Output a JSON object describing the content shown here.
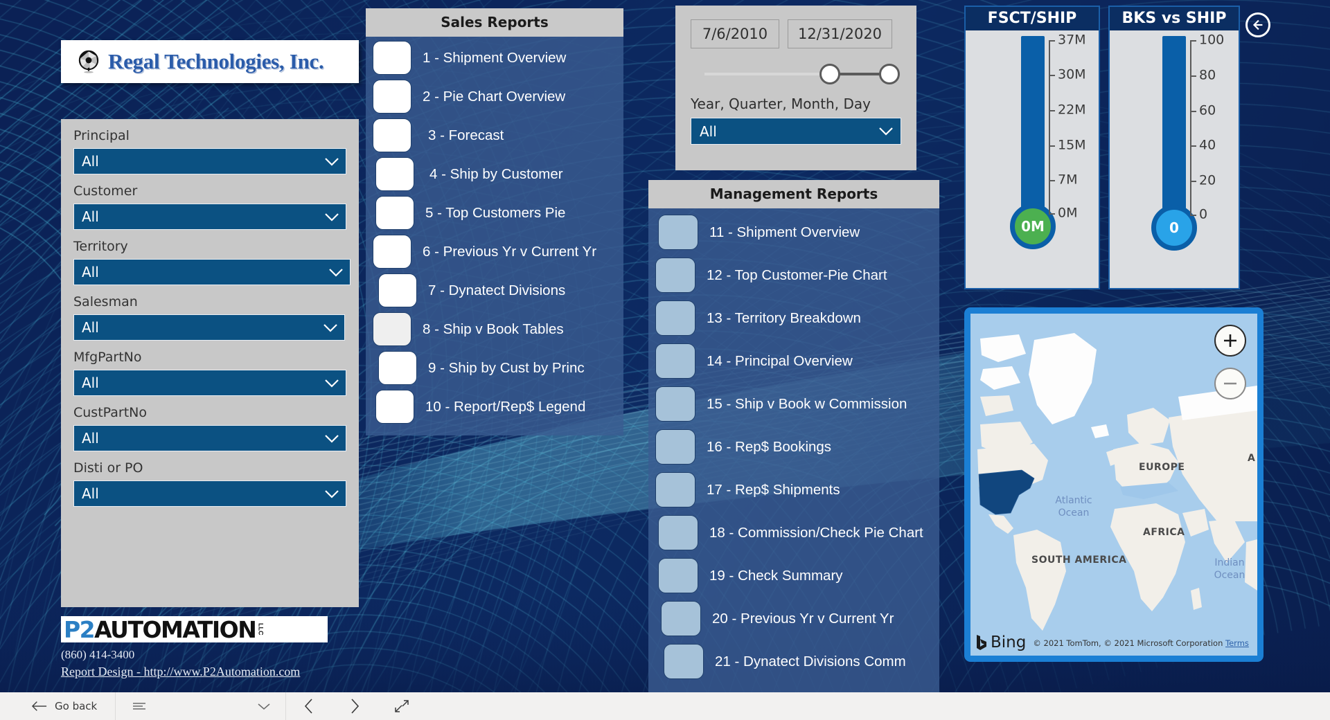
{
  "brand": {
    "company_name": "Regal Technologies, Inc.",
    "logo_icon": "camera-aperture-icon"
  },
  "filters": {
    "items": [
      {
        "label": "Principal",
        "value": "All"
      },
      {
        "label": "Customer",
        "value": "All"
      },
      {
        "label": "Territory",
        "value": "All"
      },
      {
        "label": "Salesman",
        "value": "All"
      },
      {
        "label": "MfgPartNo",
        "value": "All"
      },
      {
        "label": "CustPartNo",
        "value": "All"
      },
      {
        "label": "Disti or PO",
        "value": "All"
      }
    ]
  },
  "footer": {
    "logo_p2": "P2",
    "logo_automation": "AUTOMATION",
    "logo_suffix": "LLC",
    "phone": "(860) 414-3400",
    "link_text": "Report Design - http://www.P2Automation.com"
  },
  "sales_reports": {
    "header": "Sales Reports",
    "items": [
      "1 - Shipment Overview",
      "2 - Pie Chart Overview",
      "3 - Forecast",
      "4 - Ship by Customer",
      "5 - Top Customers Pie",
      "6 - Previous Yr v Current Yr",
      "7 - Dynatect Divisions",
      "8 - Ship v Book Tables",
      "9 - Ship by Cust by Princ",
      "10 - Report/Rep$ Legend"
    ]
  },
  "management_reports": {
    "header": "Management Reports",
    "items": [
      "11 - Shipment Overview",
      "12 - Top Customer-Pie Chart",
      "13 - Territory Breakdown",
      "14 - Principal Overview",
      "15 - Ship v Book w Commission",
      "16 - Rep$ Bookings",
      "17 - Rep$ Shipments",
      "18 - Commission/Check Pie Chart",
      "19 - Check Summary",
      "20 - Previous Yr v Current Yr",
      "21 - Dynatect Divisions Comm"
    ]
  },
  "date_slicer": {
    "start_date": "7/6/2010",
    "end_date": "12/31/2020",
    "granularity_label": "Year, Quarter, Month, Day",
    "granularity_value": "All"
  },
  "chart_data": [
    {
      "type": "bar",
      "title": "FSCT/SHIP",
      "ylabel": "",
      "tick_labels": [
        "0M",
        "7M",
        "15M",
        "22M",
        "30M",
        "37M"
      ],
      "tick_values": [
        0,
        7,
        15,
        22,
        30,
        37
      ],
      "ylim": [
        0,
        37
      ],
      "value": 0,
      "value_label": "0M",
      "bulb_color": "#4cb050",
      "bar_color": "#0a5fa8"
    },
    {
      "type": "bar",
      "title": "BKS vs SHIP",
      "ylabel": "",
      "tick_labels": [
        "0",
        "20",
        "40",
        "60",
        "80",
        "100"
      ],
      "tick_values": [
        0,
        20,
        40,
        60,
        80,
        100
      ],
      "ylim": [
        0,
        100
      ],
      "value": 0,
      "value_label": "0",
      "bulb_color": "#29a3e8",
      "bar_color": "#0a5fa8"
    }
  ],
  "map": {
    "zoom_in_icon": "plus-icon",
    "zoom_out_icon": "minus-icon",
    "labels": [
      "EUROPE",
      "AFRICA",
      "SOUTH AMERICA",
      "A"
    ],
    "ocean_atlantic": "Atlantic\nOcean",
    "ocean_indian": "Indian\nOcean",
    "provider": "Bing",
    "attribution": "© 2021 TomTom, © 2021 Microsoft Corporation",
    "terms": "Terms"
  },
  "nav": {
    "back_circle_icon": "back-arrow-circle-icon"
  },
  "toolbar": {
    "go_back_label": "Go back",
    "back_icon": "arrow-left-icon",
    "menu_icon": "hamburger-icon",
    "menu_chevron_icon": "chevron-down-icon",
    "prev_icon": "chevron-left-icon",
    "next_icon": "chevron-right-icon",
    "fit_icon": "fit-to-screen-icon"
  },
  "colors": {
    "background_navy": "#0b2155",
    "accent_cyan": "#3fc8e0",
    "dropdown_blue": "#0b5182",
    "panel_gray": "#c8c8c8",
    "report_panel_blue": "#3b5d91"
  }
}
